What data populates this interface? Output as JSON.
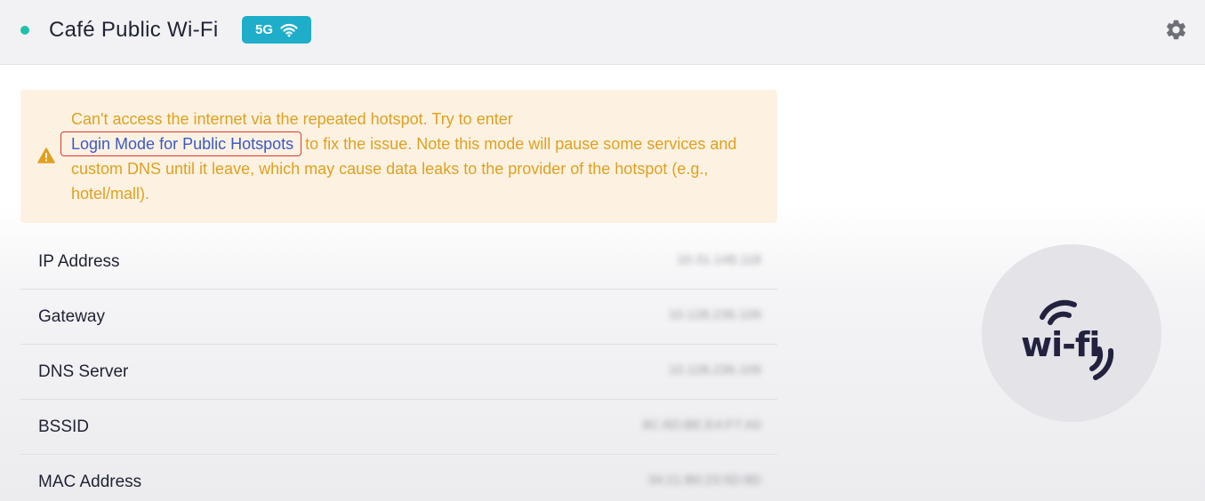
{
  "header": {
    "network_name": "Café Public Wi-Fi",
    "band_badge": "5G",
    "band_icon": "wifi-signal-icon",
    "settings_icon": "gear-icon",
    "status_color": "#1ec2a8",
    "badge_color": "#1eaec9"
  },
  "alert": {
    "icon": "warning-icon",
    "text_before_link": "Can't access the internet via the repeated hotspot. Try to enter",
    "link_label": "Login Mode for Public Hotspots",
    "text_after_link": " to fix the issue. Note this mode will pause some services and custom DNS until it leave, which may cause data leaks to the provider of the hotspot (e.g., hotel/mall).",
    "text_color": "#e0a01f",
    "link_color": "#3b59c9",
    "background": "#fdf2e2"
  },
  "info": {
    "rows": [
      {
        "label": "IP Address",
        "value": "10.31.148.118"
      },
      {
        "label": "Gateway",
        "value": "10.128.236.109"
      },
      {
        "label": "DNS Server",
        "value": "10.128.236.109"
      },
      {
        "label": "BSSID",
        "value": "8C:6D:BE:E4:F7:A0"
      },
      {
        "label": "MAC Address",
        "value": "34:21:B0:23:5D:8D"
      }
    ]
  },
  "logo": {
    "icon": "wifi-logo-icon",
    "text": "wi-fi"
  }
}
